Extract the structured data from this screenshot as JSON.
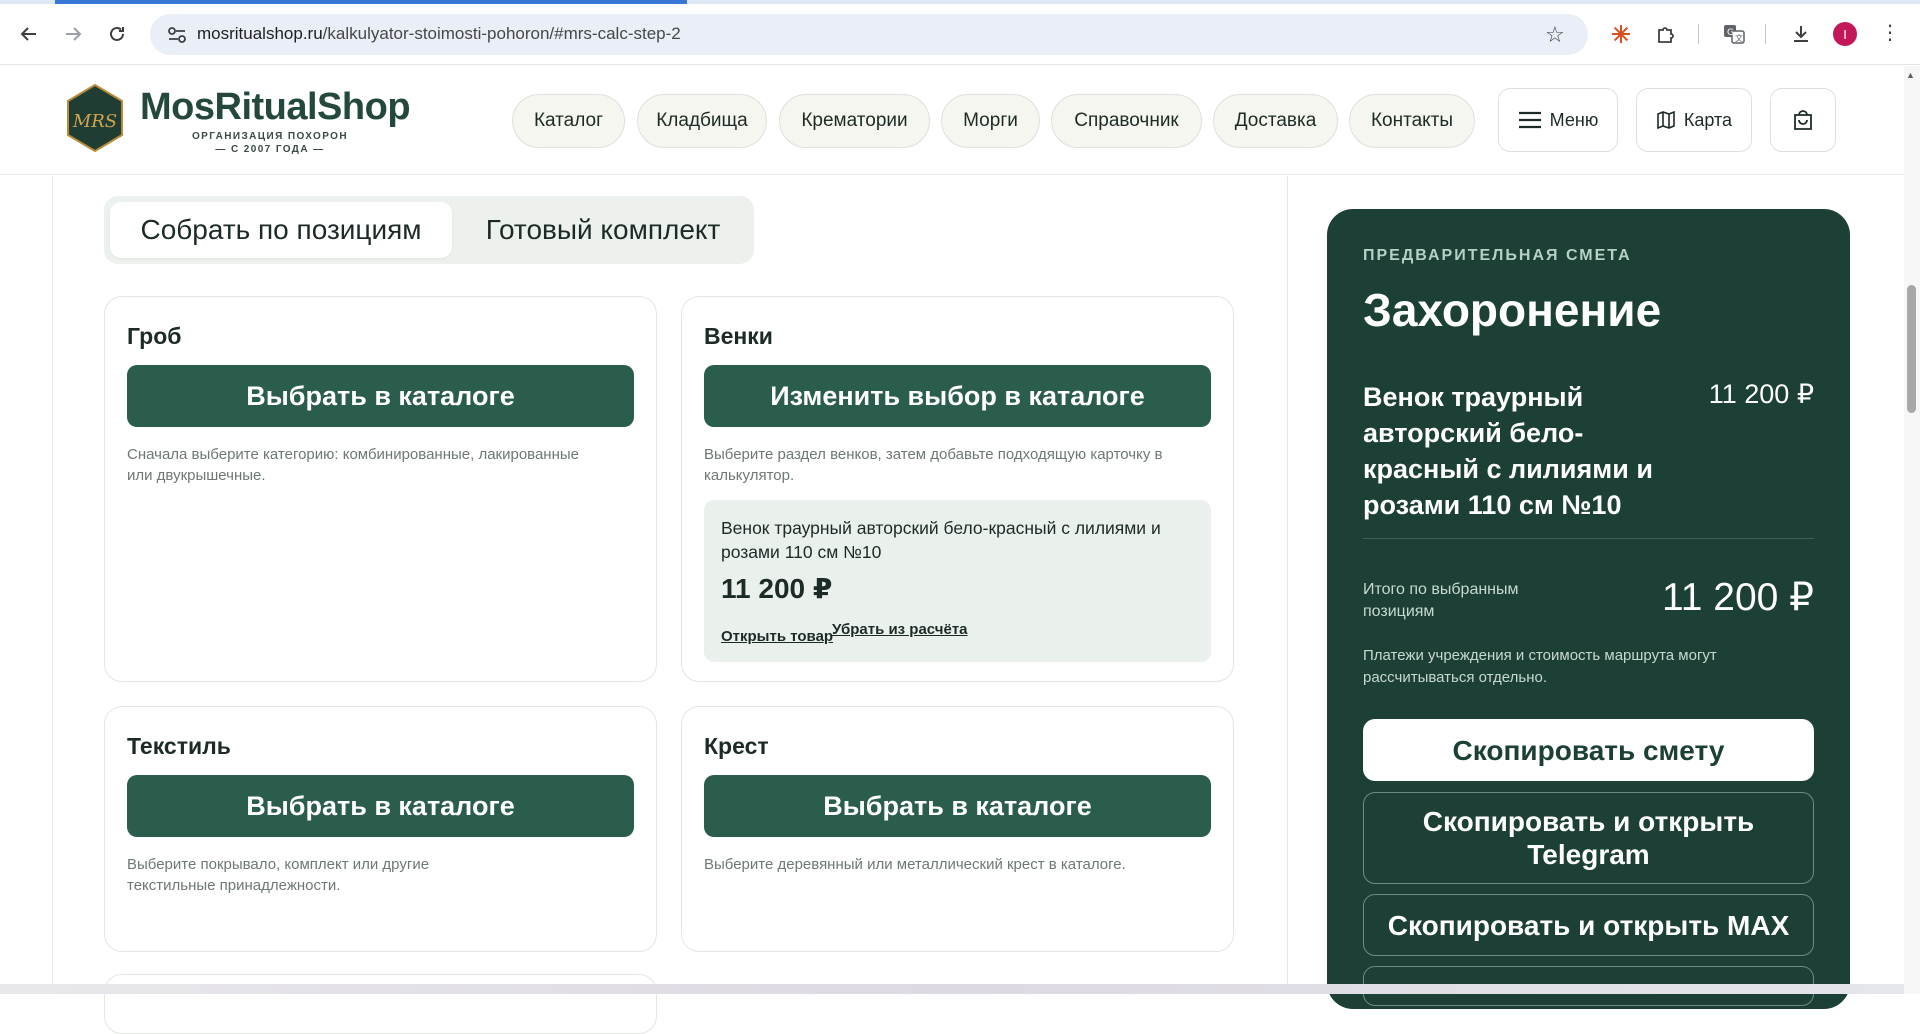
{
  "browser": {
    "url_host": "mosritualshop.ru",
    "url_path": "/kalkulyator-stoimosti-pohoron/#mrs-calc-step-2",
    "profile_initial": "I"
  },
  "header": {
    "logo": {
      "name": "MosRitualShop",
      "sub_line1": "ОРГАНИЗАЦИЯ ПОХОРОН",
      "sub_line2": "— С 2007 ГОДА —",
      "badge_text": "MRS"
    },
    "nav": [
      "Каталог",
      "Кладбища",
      "Крематории",
      "Морги",
      "Справочник",
      "Доставка",
      "Контакты"
    ],
    "menu_label": "Меню",
    "map_label": "Карта"
  },
  "mode_switch": {
    "by_items": "Собрать по позициям",
    "ready_set": "Готовый комплект"
  },
  "cards": [
    {
      "title": "Гроб",
      "button": "Выбрать в каталоге",
      "hint": "Сначала выберите категорию: комбинированные, лакированные или двукрышечные."
    },
    {
      "title": "Венки",
      "button": "Изменить выбор в каталоге",
      "hint": "Выберите раздел венков, затем добавьте подходящую карточку в калькулятор.",
      "selected": {
        "name": "Венок траурный авторский бело-красный с лилиями и розами 110 см №10",
        "price": "11 200 ₽",
        "open_link": "Открыть товар",
        "remove_link": "Убрать из расчёта"
      }
    },
    {
      "title": "Текстиль",
      "button": "Выбрать в каталоге",
      "hint": "Выберите покрывало, комплект или другие текстильные принадлежности."
    },
    {
      "title": "Крест",
      "button": "Выбрать в каталоге",
      "hint": "Выберите деревянный или металлический крест в каталоге."
    }
  ],
  "estimate": {
    "kicker": "ПРЕДВАРИТЕЛЬНАЯ СМЕТА",
    "title": "Захоронение",
    "item_name": "Венок траурный авторский бело-красный с лилиями и розами 110 см №10",
    "item_price": "11 200 ₽",
    "total_label": "Итого по выбранным позициям",
    "total_value": "11 200 ₽",
    "note": "Платежи учреждения и стоимость маршрута могут рассчитываться отдельно.",
    "copy_btn": "Скопировать смету",
    "copy_tg_btn": "Скопировать и открыть Telegram",
    "copy_max_btn": "Скопировать и открыть MAX"
  },
  "colors": {
    "brand_green": "#2b5d4d",
    "estimate_bg": "#1c4035",
    "accent_light": "#eaf0ec"
  }
}
